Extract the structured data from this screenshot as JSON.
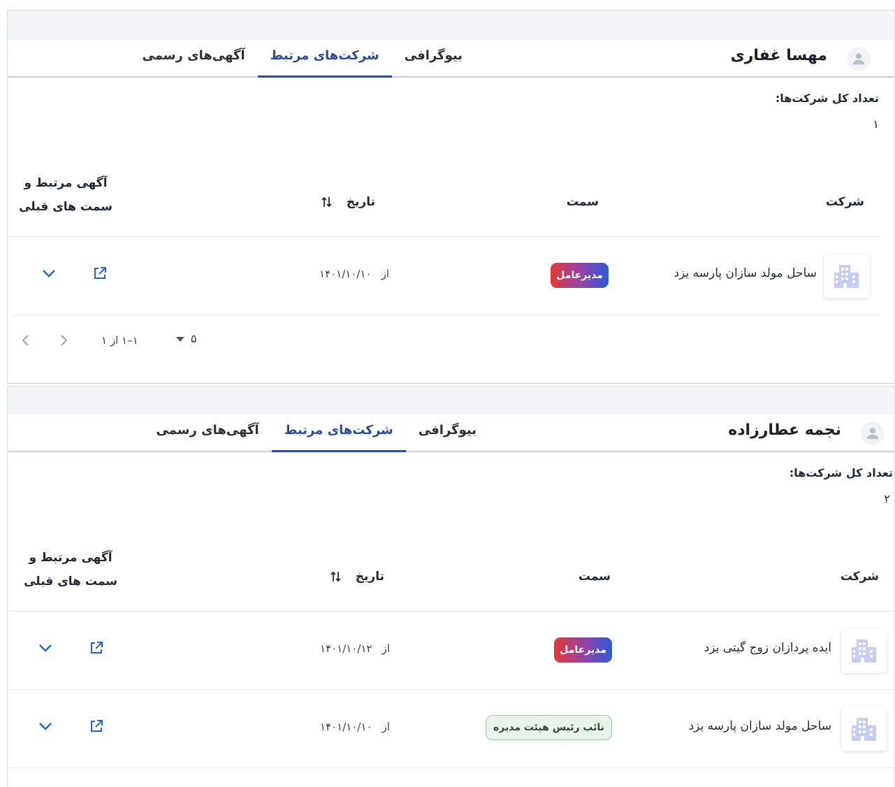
{
  "colors": {
    "accent": "#2b4a9a",
    "tab_underline": "#c7cdf0",
    "icon_blue": "#1e66d6",
    "badge_green_bg": "#e9f5ea"
  },
  "panels": [
    {
      "person_name": "مهسا غفاری",
      "tabs": [
        "بیوگرافی",
        "شرکت‌های مرتبط",
        "آگهی‌های رسمی"
      ],
      "active_tab": 1,
      "total_label": "تعداد کل شرکت‌ها:",
      "total_value": "۱",
      "columns": {
        "company": "شرکت",
        "position": "سمت",
        "date": "تاریخ",
        "ads_line1": "آگهی مرتبط و",
        "ads_line2": "سمت های قبلی"
      },
      "rows": [
        {
          "company": "ساحل مولد سازان پارسه یزد",
          "position": "مدیرعامل",
          "position_style": "red",
          "date_prefix": "از",
          "date": "۱۴۰۱/۱۰/۱۰"
        }
      ],
      "pagination": {
        "per_page": "۵",
        "range": "۱–۱ از ۱"
      }
    },
    {
      "person_name": "نجمه عطارزاده",
      "tabs": [
        "بیوگرافی",
        "شرکت‌های مرتبط",
        "آگهی‌های رسمی"
      ],
      "active_tab": 1,
      "total_label": "تعداد کل شرکت‌ها:",
      "total_value": "۲",
      "columns": {
        "company": "شرکت",
        "position": "سمت",
        "date": "تاریخ",
        "ads_line1": "آگهی مرتبط و",
        "ads_line2": "سمت های قبلی"
      },
      "rows": [
        {
          "company": "ایده پردازان زوج گیتی یزد",
          "position": "مدیرعامل",
          "position_style": "red",
          "date_prefix": "از",
          "date": "۱۴۰۱/۱۰/۱۲"
        },
        {
          "company": "ساحل مولد سازان پارسه یزد",
          "position": "نائب رئیس هیئت مدیره",
          "position_style": "green",
          "date_prefix": "از",
          "date": "۱۴۰۱/۱۰/۱۰"
        }
      ]
    }
  ]
}
